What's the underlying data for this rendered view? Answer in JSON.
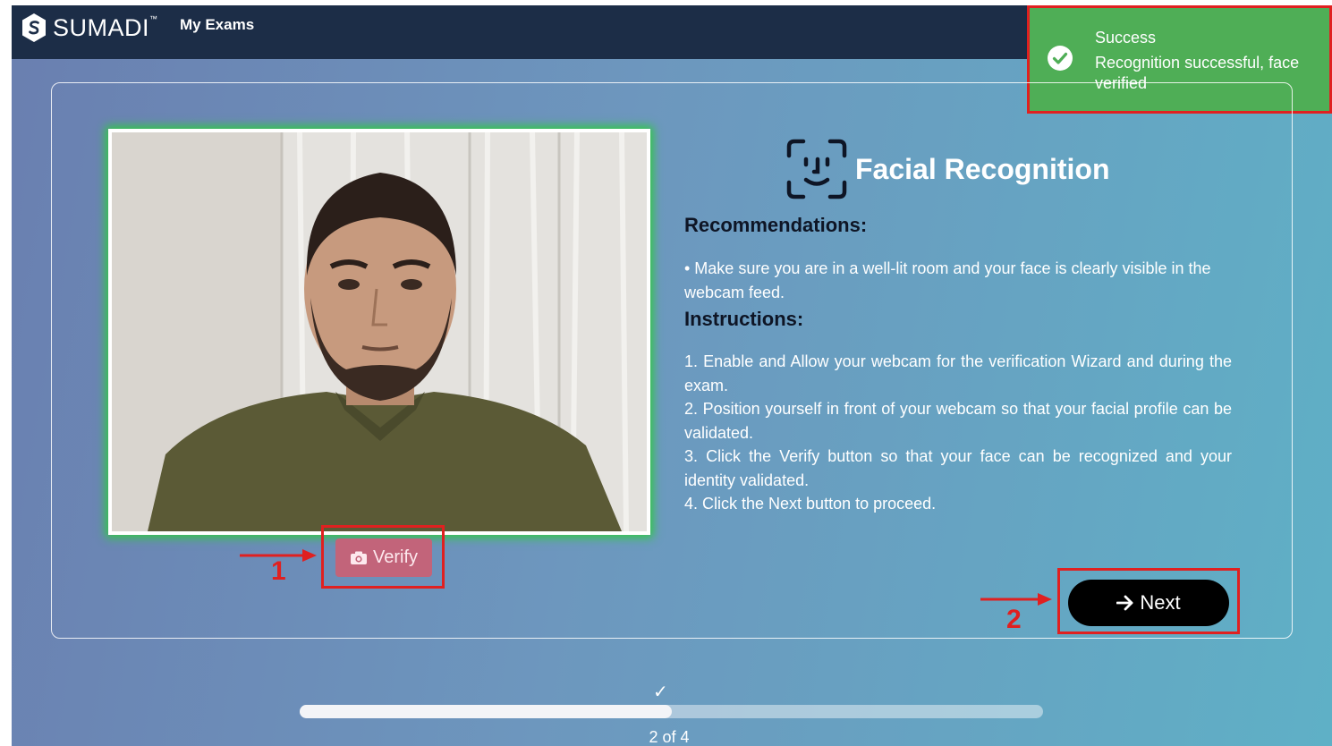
{
  "navbar": {
    "brand": "SUMADI",
    "brand_tm": "™",
    "my_exams": "My Exams"
  },
  "toast": {
    "title": "Success",
    "message": "Recognition successful, face verified",
    "color": "#4fae56"
  },
  "section": {
    "title": "Facial Recognition",
    "recommendations_heading": "Recommendations:",
    "recommendation": "• Make sure you are in a well-lit room and your face is clearly visible in the webcam feed.",
    "instructions_heading": "Instructions:",
    "instructions": [
      "1. Enable and Allow your webcam for the verification Wizard and during the exam.",
      "2. Position yourself in front of your webcam so that your facial profile can be validated.",
      "3. Click the Verify button so that your face can be recognized and your identity validated.",
      "4. Click the Next button to proceed."
    ]
  },
  "buttons": {
    "verify": "Verify",
    "next": "Next"
  },
  "annotations": {
    "step1": "1",
    "step2": "2",
    "highlight_color": "#e02020"
  },
  "progress": {
    "label": "2 of 4",
    "current": 2,
    "total": 4,
    "fraction": 0.5,
    "check": "✓"
  }
}
